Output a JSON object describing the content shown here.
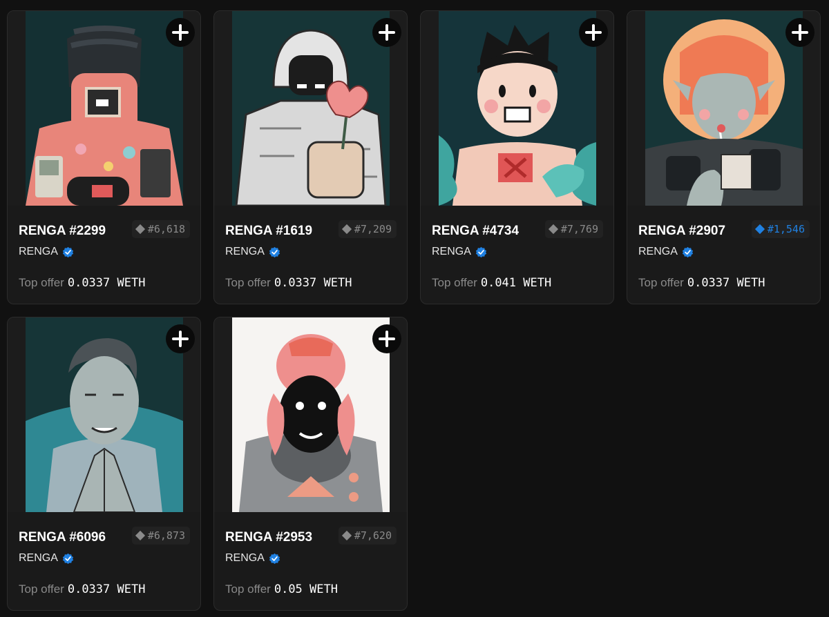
{
  "icons": {
    "add": "plus-circle-icon",
    "rank": "diamond-icon",
    "verified": "verified-badge-icon"
  },
  "colors": {
    "background": "#111111",
    "card": "#1a1a1a",
    "rank_highlight": "#2081e2",
    "verified": "#2081e2"
  },
  "labels": {
    "top_offer": "Top offer"
  },
  "items": [
    {
      "title": "RENGA #2299",
      "rank": "#6,618",
      "rank_highlight": false,
      "collection": "RENGA",
      "price": "0.0337 WETH",
      "art": "retro-gadget-man"
    },
    {
      "title": "RENGA #1619",
      "rank": "#7,209",
      "rank_highlight": false,
      "collection": "RENGA",
      "price": "0.0337 WETH",
      "art": "armored-knight-rose"
    },
    {
      "title": "RENGA #4734",
      "rank": "#7,769",
      "rank_highlight": false,
      "collection": "RENGA",
      "price": "0.041 WETH",
      "art": "spiky-hair-boy"
    },
    {
      "title": "RENGA #2907",
      "rank": "#1,546",
      "rank_highlight": true,
      "collection": "RENGA",
      "price": "0.0337 WETH",
      "art": "orange-hair-girl"
    },
    {
      "title": "RENGA #6096",
      "rank": "#6,873",
      "rank_highlight": false,
      "collection": "RENGA",
      "price": "0.0337 WETH",
      "art": "steepled-hands-man"
    },
    {
      "title": "RENGA #2953",
      "rank": "#7,620",
      "rank_highlight": false,
      "collection": "RENGA",
      "price": "0.05 WETH",
      "art": "octopus-head-figure"
    }
  ]
}
